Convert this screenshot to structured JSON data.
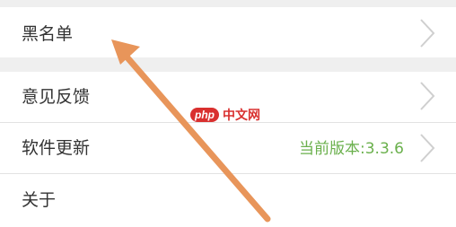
{
  "settings": {
    "items": [
      {
        "label": "黑名单",
        "icon": "chevron-right-icon"
      },
      {
        "label": "意见反馈",
        "icon": "chevron-right-icon"
      },
      {
        "label": "软件更新",
        "value": "当前版本:3.3.6",
        "icon": "chevron-right-icon"
      },
      {
        "label": "关于"
      }
    ]
  },
  "watermark": {
    "logo_text": "php",
    "site_text": "中文网"
  },
  "colors": {
    "version_text": "#6ab04c",
    "arrow": "#e8955a",
    "background_gap": "#efefef",
    "watermark": "#d9302f"
  }
}
